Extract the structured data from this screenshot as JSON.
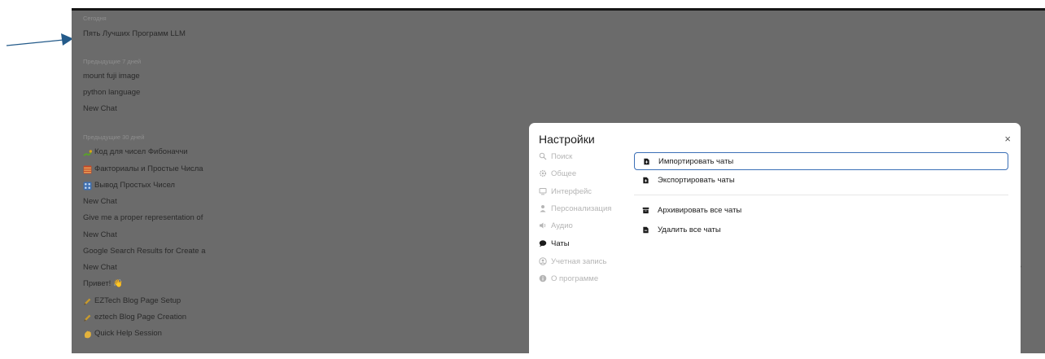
{
  "sidebar": {
    "groups": [
      {
        "label": "Сегодня",
        "items": [
          {
            "title": "Пять Лучших Программ LLM",
            "icon": ""
          }
        ]
      },
      {
        "label": "Предыдущие 7 дней",
        "items": [
          {
            "title": "mount fuji image",
            "icon": ""
          },
          {
            "title": "python language",
            "icon": ""
          },
          {
            "title": "New Chat",
            "icon": ""
          }
        ]
      },
      {
        "label": "Предыдущие 30 дней",
        "items": [
          {
            "title": "Код для чисел Фибоначчи",
            "icon": "snake-emoji-icon"
          },
          {
            "title": "Факториалы и Простые Числа",
            "icon": "abacus-emoji-icon"
          },
          {
            "title": "Вывод Простых Чисел",
            "icon": "numbers-emoji-icon"
          },
          {
            "title": "New Chat",
            "icon": ""
          },
          {
            "title": "Give me a proper representation of",
            "icon": ""
          },
          {
            "title": "New Chat",
            "icon": ""
          },
          {
            "title": "Google Search Results for Create a",
            "icon": ""
          },
          {
            "title": "New Chat",
            "icon": ""
          },
          {
            "title": "Привет! 👋",
            "icon": ""
          },
          {
            "title": "EZTech Blog Page Setup",
            "icon": "pencil-emoji-icon"
          },
          {
            "title": "eztech Blog Page Creation",
            "icon": "pencil-emoji-icon"
          },
          {
            "title": "Quick Help Session",
            "icon": "wave-emoji-icon"
          }
        ]
      }
    ]
  },
  "settings": {
    "title": "Настройки",
    "close_label": "×",
    "nav": [
      {
        "label": "Поиск",
        "icon": "search-icon",
        "active": false
      },
      {
        "label": "Общее",
        "icon": "gear-icon",
        "active": false
      },
      {
        "label": "Интерфейс",
        "icon": "monitor-icon",
        "active": false
      },
      {
        "label": "Персонализация",
        "icon": "user-icon",
        "active": false
      },
      {
        "label": "Аудио",
        "icon": "speaker-icon",
        "active": false
      },
      {
        "label": "Чаты",
        "icon": "chat-bubble-icon",
        "active": true
      },
      {
        "label": "Учетная запись",
        "icon": "account-icon",
        "active": false
      },
      {
        "label": "О программе",
        "icon": "info-icon",
        "active": false
      }
    ],
    "actions": [
      {
        "label": "Импортировать чаты",
        "icon": "file-import-icon",
        "focused": true
      },
      {
        "label": "Экспортировать чаты",
        "icon": "file-export-icon",
        "focused": false
      },
      {
        "label": "Архивировать все чаты",
        "icon": "archive-box-icon",
        "focused": false
      },
      {
        "label": "Удалить все чаты",
        "icon": "file-delete-icon",
        "focused": false
      }
    ]
  },
  "colors": {
    "backdrop": "#6b6b6b",
    "arrow": "#245b8a",
    "focus_border": "#3b6fb6",
    "active_text": "#1b1b1b",
    "inactive_text": "#b5b5b5"
  }
}
